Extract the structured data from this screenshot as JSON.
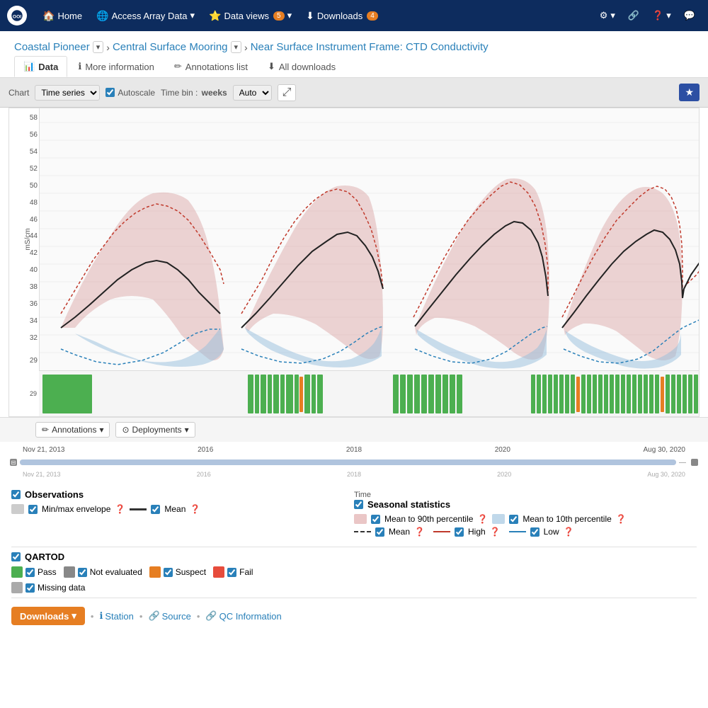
{
  "navbar": {
    "brand_icon": "OOI",
    "home_label": "Home",
    "access_array_label": "Access Array Data",
    "dataviews_label": "Data views",
    "dataviews_badge": "5",
    "downloads_label": "Downloads",
    "downloads_badge": "4"
  },
  "breadcrumb": {
    "level1": "Coastal Pioneer",
    "level2": "Central Surface Mooring",
    "level3": "Near Surface Instrument Frame: CTD Conductivity"
  },
  "tabs": {
    "data_label": "Data",
    "more_info_label": "More information",
    "annotations_label": "Annotations list",
    "all_downloads_label": "All downloads"
  },
  "toolbar": {
    "chart_label": "Chart",
    "chart_type": "Time series",
    "autoscale_label": "Autoscale",
    "timebin_label": "Time bin :",
    "timebin_unit": "weeks",
    "timebin_value": "Auto",
    "expand_icon": "⤢",
    "star_icon": "★"
  },
  "chart": {
    "yaxis_unit": "mS/cm",
    "yaxis_values": [
      "58",
      "56",
      "54",
      "52",
      "50",
      "48",
      "46",
      "44",
      "42",
      "40",
      "38",
      "36",
      "34",
      "32",
      "29"
    ]
  },
  "time_nav": {
    "start": "Nov 21, 2013",
    "end": "Aug 30, 2020",
    "mid1": "2016",
    "mid2": "2018",
    "mid3": "2020",
    "sub_start": "Nov 21, 2013",
    "sub_mid1": "2016",
    "sub_mid2": "2018",
    "sub_mid3": "2020",
    "sub_end": "Aug 30, 2020"
  },
  "legend": {
    "observations_label": "Observations",
    "obs_minmax_label": "Min/max envelope",
    "obs_mean_label": "Mean",
    "seasonal_label": "Seasonal statistics",
    "time_label": "Time",
    "seasonal_mean_90_label": "Mean to 90th percentile",
    "seasonal_mean_10_label": "Mean to 10th percentile",
    "seasonal_mean_label": "Mean",
    "seasonal_high_label": "High",
    "seasonal_low_label": "Low"
  },
  "qartod": {
    "title": "QARTOD",
    "pass_label": "Pass",
    "not_eval_label": "Not evaluated",
    "suspect_label": "Suspect",
    "fail_label": "Fail",
    "missing_label": "Missing data"
  },
  "footer": {
    "downloads_label": "Downloads",
    "station_label": "Station",
    "source_label": "Source",
    "qc_label": "QC Information"
  },
  "annot": {
    "annotations_btn": "Annotations",
    "deployments_btn": "Deployments"
  }
}
